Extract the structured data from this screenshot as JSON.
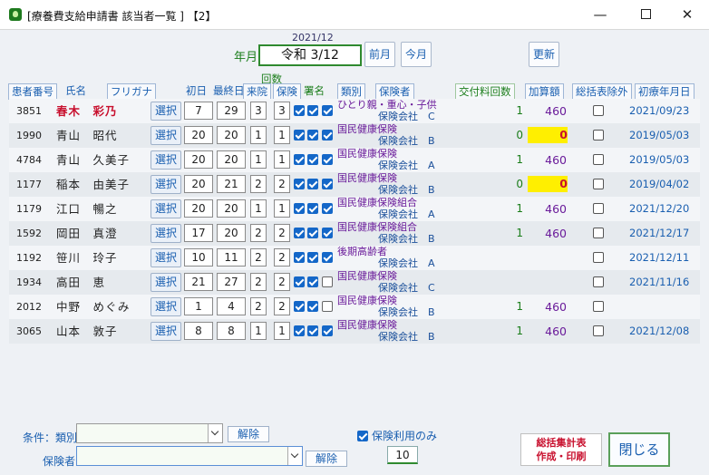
{
  "window": {
    "title": "[療養費支給申請書 該当者一覧 ]  【2】",
    "controls": {
      "minimize": "—",
      "close": "✕"
    }
  },
  "header": {
    "year_month_western": "2021/12",
    "label_year_month": "年月",
    "year_month_value": "令和 3/12",
    "prev_month": "前月",
    "this_month": "今月",
    "refresh": "更新"
  },
  "columns": {
    "patient_no": "患者番号",
    "name": "氏名",
    "kana": "フリガナ",
    "first_day": "初日",
    "last_day": "最終日",
    "count_group": "回数",
    "visits": "来院",
    "insurance_count": "保険",
    "signature": "署名",
    "category": "類別",
    "insurer": "保険者",
    "issue_count": "交付料回数",
    "addition": "加算額",
    "exclude": "総括表除外",
    "first_visit": "初療年月日"
  },
  "select_label": "選択",
  "rows": [
    {
      "id": "3851",
      "name": "春木　彩乃",
      "highlight": true,
      "first": "7",
      "last": "29",
      "visits": "3",
      "ins": "3",
      "checks": [
        true,
        true,
        true
      ],
      "category": "ひとり親・重心・子供",
      "insurer": "保険会社　C",
      "count": "1",
      "amount": "460",
      "zero": false,
      "first_visit": "2021/09/23"
    },
    {
      "id": "1990",
      "name": "青山　昭代",
      "highlight": false,
      "first": "20",
      "last": "20",
      "visits": "1",
      "ins": "1",
      "checks": [
        true,
        true,
        true
      ],
      "category": "国民健康保険",
      "insurer": "保険会社　B",
      "count": "0",
      "amount": "0",
      "zero": true,
      "first_visit": "2019/05/03"
    },
    {
      "id": "4784",
      "name": "青山　久美子",
      "highlight": false,
      "first": "20",
      "last": "20",
      "visits": "1",
      "ins": "1",
      "checks": [
        true,
        true,
        true
      ],
      "category": "国民健康保険",
      "insurer": "保険会社　A",
      "count": "1",
      "amount": "460",
      "zero": false,
      "first_visit": "2019/05/03"
    },
    {
      "id": "1177",
      "name": "稲本　由美子",
      "highlight": false,
      "first": "20",
      "last": "21",
      "visits": "2",
      "ins": "2",
      "checks": [
        true,
        true,
        true
      ],
      "category": "国民健康保険",
      "insurer": "保険会社　B",
      "count": "0",
      "amount": "0",
      "zero": true,
      "first_visit": "2019/04/02"
    },
    {
      "id": "1179",
      "name": "江口　暢之",
      "highlight": false,
      "first": "20",
      "last": "20",
      "visits": "1",
      "ins": "1",
      "checks": [
        true,
        true,
        true
      ],
      "category": "国民健康保険組合",
      "insurer": "保険会社　A",
      "count": "1",
      "amount": "460",
      "zero": false,
      "first_visit": "2021/12/20"
    },
    {
      "id": "1592",
      "name": "岡田　真澄",
      "highlight": false,
      "first": "17",
      "last": "20",
      "visits": "2",
      "ins": "2",
      "checks": [
        true,
        true,
        true
      ],
      "category": "国民健康保険組合",
      "insurer": "保険会社　B",
      "count": "1",
      "amount": "460",
      "zero": false,
      "first_visit": "2021/12/17"
    },
    {
      "id": "1192",
      "name": "笹川　玲子",
      "highlight": false,
      "first": "10",
      "last": "11",
      "visits": "2",
      "ins": "2",
      "checks": [
        true,
        true,
        true
      ],
      "category": "後期高齢者",
      "insurer": "保険会社　A",
      "count": "",
      "amount": "",
      "zero": false,
      "first_visit": "2021/12/11"
    },
    {
      "id": "1934",
      "name": "高田　恵",
      "highlight": false,
      "first": "21",
      "last": "27",
      "visits": "2",
      "ins": "2",
      "checks": [
        true,
        true,
        false
      ],
      "category": "国民健康保険",
      "insurer": "保険会社　C",
      "count": "",
      "amount": "",
      "zero": false,
      "first_visit": "2021/11/16"
    },
    {
      "id": "2012",
      "name": "中野　めぐみ",
      "highlight": false,
      "first": "1",
      "last": "4",
      "visits": "2",
      "ins": "2",
      "checks": [
        true,
        true,
        false
      ],
      "category": "国民健康保険",
      "insurer": "保険会社　B",
      "count": "1",
      "amount": "460",
      "zero": false,
      "first_visit": ""
    },
    {
      "id": "3065",
      "name": "山本　敦子",
      "highlight": false,
      "first": "8",
      "last": "8",
      "visits": "1",
      "ins": "1",
      "checks": [
        true,
        true,
        true
      ],
      "category": "国民健康保険",
      "insurer": "保険会社　B",
      "count": "1",
      "amount": "460",
      "zero": false,
      "first_visit": "2021/12/08"
    }
  ],
  "footer": {
    "cond_category_label": "条件：類別",
    "insurer_label": "保険者",
    "clear1": "解除",
    "clear2": "解除",
    "insurance_only": "保険利用のみ",
    "total_count": "10",
    "report_button_line1": "総括集計表",
    "report_button_line2": "作成・印刷",
    "close_button": "閉じる"
  }
}
